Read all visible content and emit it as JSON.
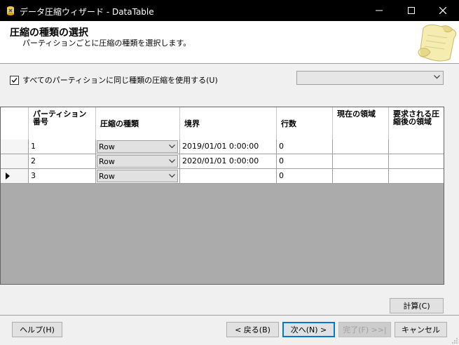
{
  "window": {
    "title": "データ圧縮ウィザード - DataTable",
    "controls": [
      "minimize",
      "maximize",
      "close"
    ]
  },
  "header": {
    "title": "圧縮の種類の選択",
    "subtitle": "パーティションごとに圧縮の種類を選択します。"
  },
  "options": {
    "same_compression_label": "すべてのパーティションに同じ種類の圧縮を使用する(U)",
    "same_compression_checked": true,
    "compression_select_value": ""
  },
  "grid": {
    "columns": [
      "パーティション番号",
      "圧縮の種類",
      "境界",
      "行数",
      "現在の領域",
      "要求される圧縮後の領域"
    ],
    "rows": [
      {
        "partition": "1",
        "compression": "Row",
        "boundary": "2019/01/01 0:00:00",
        "rows": "0",
        "current": "",
        "requested": ""
      },
      {
        "partition": "2",
        "compression": "Row",
        "boundary": "2020/01/01 0:00:00",
        "rows": "0",
        "current": "",
        "requested": ""
      },
      {
        "partition": "3",
        "compression": "Row",
        "boundary": "",
        "rows": "0",
        "current": "",
        "requested": ""
      }
    ],
    "current_row_index": 2
  },
  "buttons": {
    "calculate": "計算(C)",
    "help": "ヘルプ(H)",
    "back": "< 戻る(B)",
    "next": "次へ(N) >",
    "finish": "完了(F) >>|",
    "cancel": "キャンセル"
  }
}
